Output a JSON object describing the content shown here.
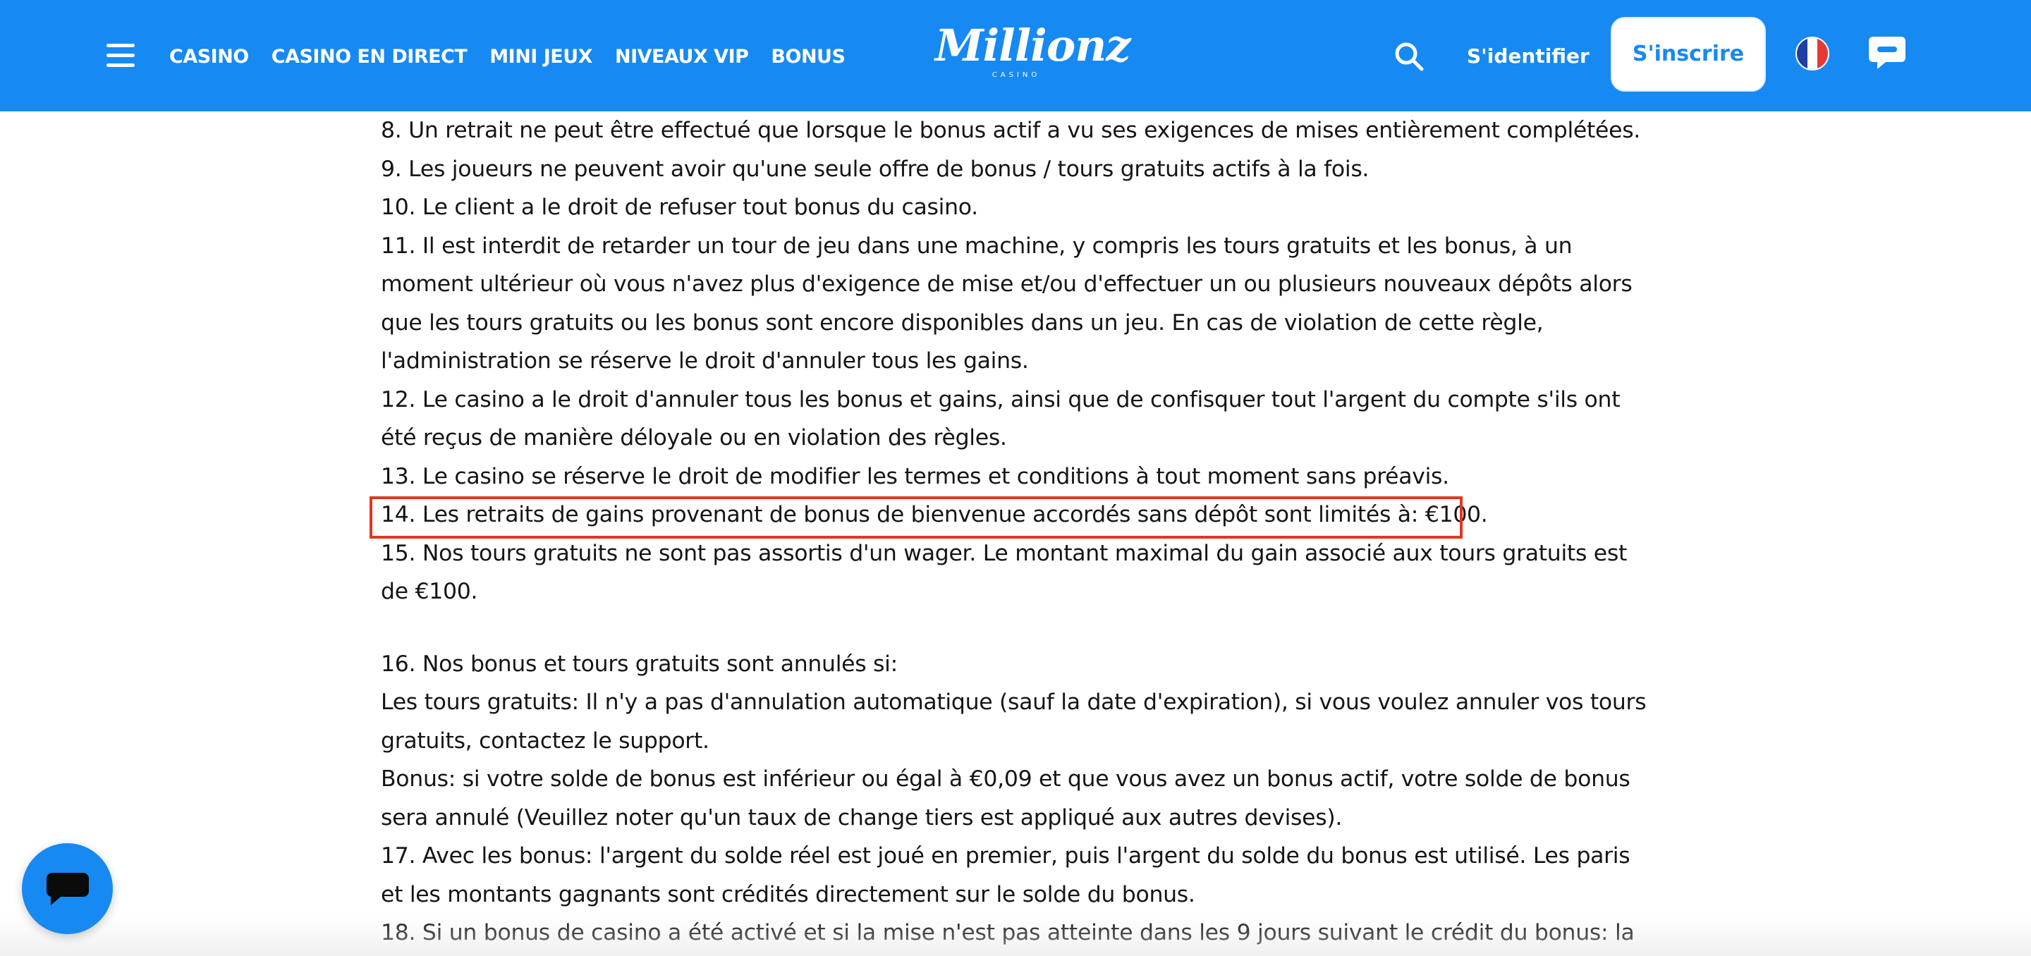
{
  "header": {
    "nav": [
      "CASINO",
      "CASINO EN DIRECT",
      "MINI JEUX",
      "NIVEAUX VIP",
      "BONUS"
    ],
    "logo": {
      "word": "Millionz",
      "sub": "CASINO"
    },
    "login_label": "S'identifier",
    "signup_label": "S'inscrire",
    "language_flag": {
      "country": "France",
      "colors": [
        "#1f3fa3",
        "#ffffff",
        "#e53935"
      ]
    },
    "icons": [
      "menu-icon",
      "search-icon",
      "chat-icon",
      "france-flag-icon"
    ]
  },
  "colors": {
    "header_bg": "#1789f2",
    "highlight": "#e2371f",
    "text": "#151515"
  },
  "content": {
    "paragraphs": [
      "8. Un retrait ne peut être effectué que lorsque le bonus actif a vu ses exigences de mises entièrement complétées.",
      "9. Les joueurs ne peuvent avoir qu'une seule offre de bonus / tours gratuits actifs à la fois.",
      "10. Le client a le droit de refuser tout bonus du casino.",
      "11. Il est interdit de retarder un tour de jeu dans une machine, y compris les tours gratuits et les bonus, à un moment ultérieur où vous n'avez plus d'exigence de mise et/ou d'effectuer un ou plusieurs nouveaux dépôts alors que les tours gratuits ou les bonus sont encore disponibles dans un jeu. En cas de violation de cette règle, l'administration se réserve le droit d'annuler tous les gains.",
      "12. Le casino a le droit d'annuler tous les bonus et gains, ainsi que de confisquer tout l'argent du compte s'ils ont été reçus de manière déloyale ou en violation des règles.",
      "13. Le casino se réserve le droit de modifier les termes et conditions à tout moment sans préavis.",
      "14. Les retraits de gains provenant de bonus de bienvenue accordés sans dépôt sont limités à: €100.",
      "15. Nos tours gratuits ne sont pas assortis d'un wager. Le montant maximal du gain associé aux tours gratuits est de €100.",
      "16. Nos bonus et tours gratuits sont annulés si:",
      "Les tours gratuits: Il n'y a pas d'annulation automatique (sauf la date d'expiration), si vous voulez annuler vos tours gratuits, contactez le support.",
      "Bonus: si votre solde de bonus est inférieur ou égal à €0,09 et que vous avez un bonus actif, votre solde de bonus sera annulé (Veuillez noter qu'un taux de change tiers est appliqué aux autres devises).",
      "17. Avec les bonus: l'argent du solde réel est joué en premier, puis l'argent du solde du bonus est utilisé. Les paris et les montants gagnants sont crédités directement sur le solde du bonus.",
      "18. Si un bonus de casino a été activé et si la mise n'est pas atteinte dans les 9 jours suivant le crédit du bonus: la"
    ]
  }
}
